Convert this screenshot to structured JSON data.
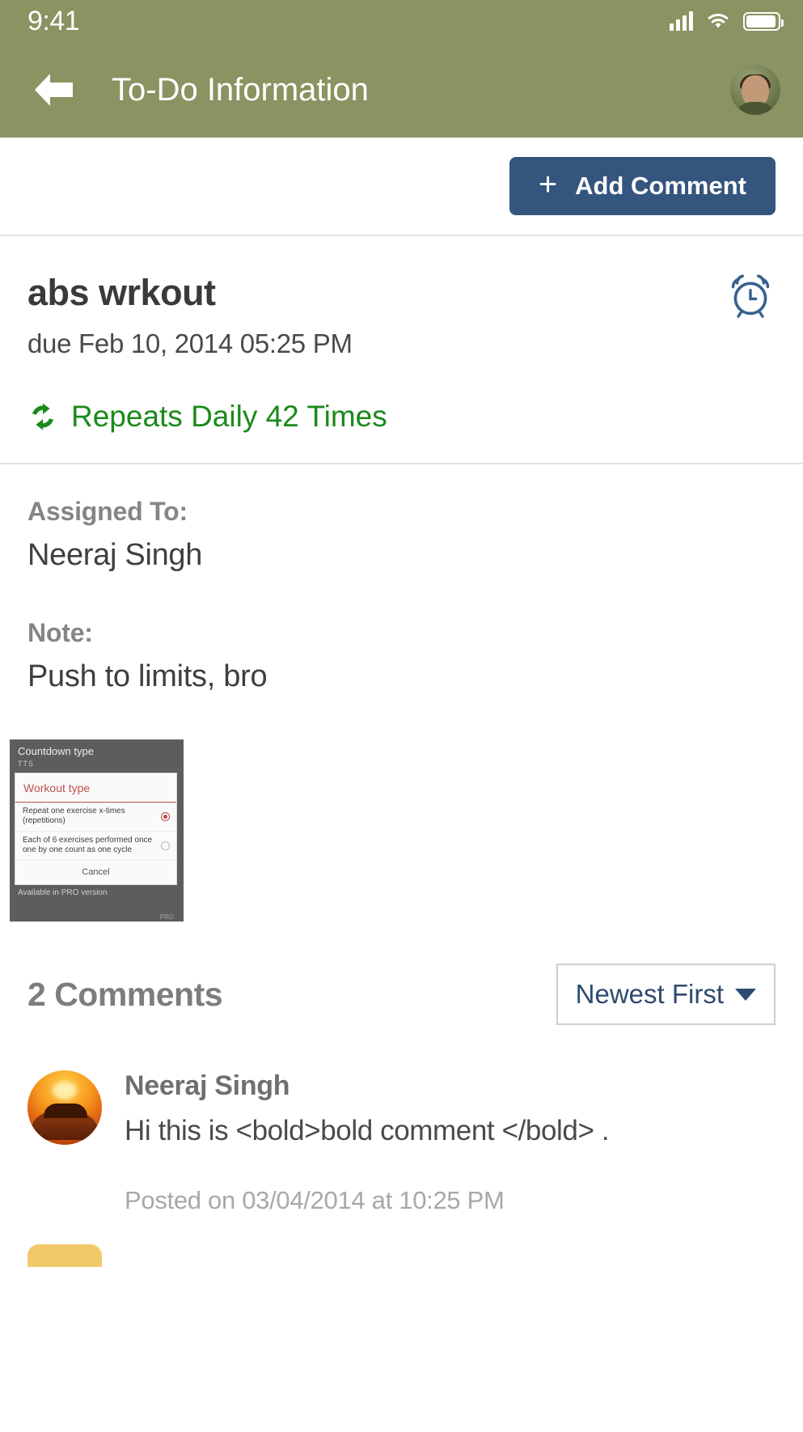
{
  "status_bar": {
    "time": "9:41",
    "icons": [
      "cellular-signal-icon",
      "wifi-icon",
      "battery-icon"
    ]
  },
  "app_bar": {
    "back_icon": "back-arrow-icon",
    "title": "To-Do Information",
    "avatar": "user-avatar"
  },
  "toolbar": {
    "add_comment_label": "Add Comment",
    "plus_glyph": "+"
  },
  "task": {
    "title": "abs wrkout",
    "due": "due Feb 10, 2014 05:25 PM",
    "repeat": "Repeats Daily 42 Times",
    "repeat_icon": "repeat-icon",
    "alarm_icon": "alarm-clock-icon"
  },
  "details": {
    "assigned_label": "Assigned To:",
    "assigned_value": "Neeraj Singh",
    "note_label": "Note:",
    "note_value": "Push to limits, bro"
  },
  "attachment": {
    "name": "attachment-thumbnail",
    "header_title": "Countdown type",
    "header_sub": "TTS",
    "dialog_title": "Workout type",
    "options": [
      {
        "text": "Repeat one exercise x-times (repetitions)",
        "selected": true
      },
      {
        "text": "Each of 6 exercises performed once one by one count as one cycle",
        "selected": false
      }
    ],
    "cancel_label": "Cancel",
    "footer_note": "Available in PRO version",
    "pro_badge": "PRO"
  },
  "comments": {
    "count_label": "2 Comments",
    "sort_label": "Newest First",
    "items": [
      {
        "author": "Neeraj Singh",
        "text": "Hi this is <bold>bold comment </bold> .",
        "timestamp": "Posted on 03/04/2014 at 10:25 PM"
      }
    ]
  },
  "colors": {
    "app_bar": "#8a9361",
    "accent_button": "#34557d",
    "repeat_green": "#1a8a1a",
    "link_blue": "#2d4b6e",
    "label_gray": "#858585"
  }
}
